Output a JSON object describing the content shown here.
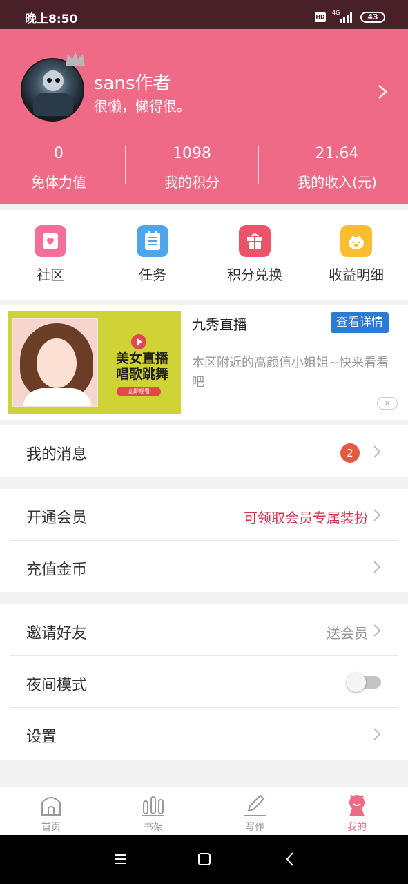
{
  "status_bar": {
    "time": "晚上8:50",
    "hd": "HD",
    "network": "4G",
    "battery": "43"
  },
  "profile": {
    "name": "sans作者",
    "bio": "很懒，懒得很。",
    "stats": [
      {
        "value": "0",
        "label": "免体力值"
      },
      {
        "value": "1098",
        "label": "我的积分"
      },
      {
        "value": "21.64",
        "label": "我的收入(元)"
      }
    ]
  },
  "shortcuts": [
    {
      "label": "社区",
      "icon": "community-icon",
      "color": "#f46f9a"
    },
    {
      "label": "任务",
      "icon": "task-icon",
      "color": "#4da6ec"
    },
    {
      "label": "积分兑换",
      "icon": "gift-icon",
      "color": "#ec5268"
    },
    {
      "label": "收益明细",
      "icon": "piggy-icon",
      "color": "#f9bd32"
    }
  ],
  "ad": {
    "title": "九秀直播",
    "detail_button": "查看详情",
    "description": "本区附近的高颜值小姐姐~快来看看吧",
    "image_headline_1": "美女直播",
    "image_headline_2": "唱歌跳舞",
    "image_cta": "立即观看",
    "close": "✕"
  },
  "menu": {
    "messages": {
      "label": "我的消息",
      "badge": "2"
    },
    "vip": {
      "label": "开通会员",
      "hint": "可领取会员专属装扮"
    },
    "recharge": {
      "label": "充值金币"
    },
    "invite": {
      "label": "邀请好友",
      "hint": "送会员"
    },
    "night_mode": {
      "label": "夜间模式",
      "enabled": false
    },
    "settings": {
      "label": "设置"
    }
  },
  "tabs": [
    {
      "label": "首页",
      "icon": "home-icon",
      "active": false
    },
    {
      "label": "书架",
      "icon": "bookshelf-icon",
      "active": false
    },
    {
      "label": "写作",
      "icon": "pen-icon",
      "active": false
    },
    {
      "label": "我的",
      "icon": "profile-icon",
      "active": true
    }
  ],
  "colors": {
    "header": "#ee6a87",
    "accent": "#ee6a87",
    "vip_hint": "#d5334f",
    "badge": "#e05b40",
    "ad_button": "#2e7bd7"
  }
}
